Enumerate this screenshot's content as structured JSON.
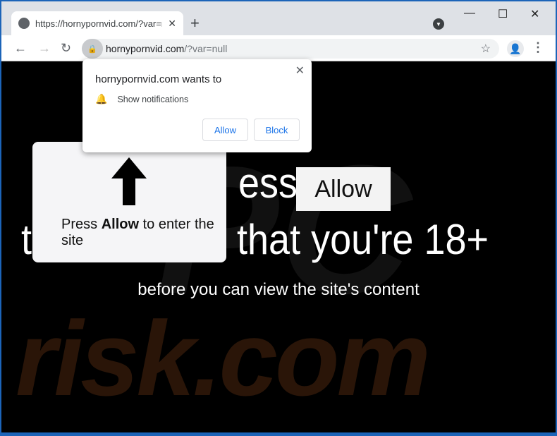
{
  "tab": {
    "title": "https://hornypornvid.com/?var=null",
    "icon": "globe-icon"
  },
  "address": {
    "host": "hornypornvid.com",
    "path": "/?var=null"
  },
  "popup": {
    "title": "hornypornvid.com wants to",
    "permission": "Show notifications",
    "allow": "Allow",
    "block": "Block"
  },
  "page": {
    "line1_visible": "ess",
    "allow_button": "Allow",
    "line2_start": "t",
    "line2_end": "that you're 18+",
    "subtitle": "before you can view the site's content",
    "card": {
      "pre": "Press ",
      "bold": "Allow",
      "post": " to enter the site"
    }
  },
  "watermark": {
    "text": "risk.com",
    "logo": "PC"
  }
}
